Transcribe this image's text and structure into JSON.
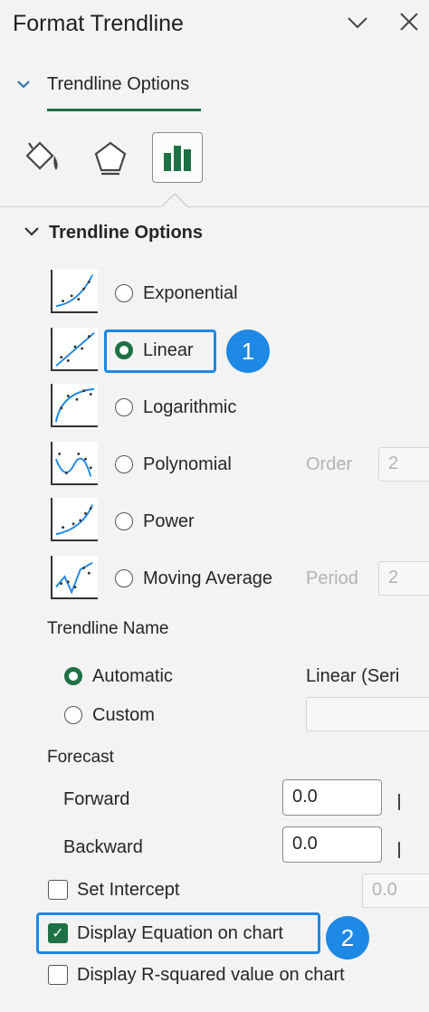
{
  "header": {
    "title": "Format Trendline",
    "collapse_icon": "chevron-down-icon",
    "close_icon": "close-icon"
  },
  "tab": {
    "label": "Trendline Options",
    "icons": [
      "fill-line-icon",
      "effects-pentagon-icon",
      "trendline-options-chart-icon"
    ]
  },
  "section": {
    "label": "Trendline Options"
  },
  "trend_types": [
    {
      "label": "Exponential",
      "selected": false
    },
    {
      "label": "Linear",
      "selected": true
    },
    {
      "label": "Logarithmic",
      "selected": false
    },
    {
      "label": "Polynomial",
      "selected": false,
      "param_label": "Order",
      "param_value": "2"
    },
    {
      "label": "Power",
      "selected": false
    },
    {
      "label": "Moving Average",
      "selected": false,
      "param_label": "Period",
      "param_value": "2"
    }
  ],
  "name_group": {
    "label": "Trendline Name",
    "automatic_label": "Automatic",
    "automatic_value": "Linear (Seri",
    "custom_label": "Custom",
    "custom_value": ""
  },
  "forecast": {
    "label": "Forecast",
    "forward_label": "Forward",
    "forward_value": "0.0",
    "backward_label": "Backward",
    "backward_value": "0.0"
  },
  "intercept": {
    "label": "Set Intercept",
    "value": "0.0",
    "checked": false
  },
  "display_equation": {
    "label": "Display Equation on chart",
    "checked": true
  },
  "display_rsquared": {
    "label": "Display R-squared value on chart",
    "checked": false
  },
  "badges": [
    "1",
    "2"
  ],
  "colors": {
    "accent_green": "#1e7145",
    "highlight_blue": "#1e88e5"
  }
}
